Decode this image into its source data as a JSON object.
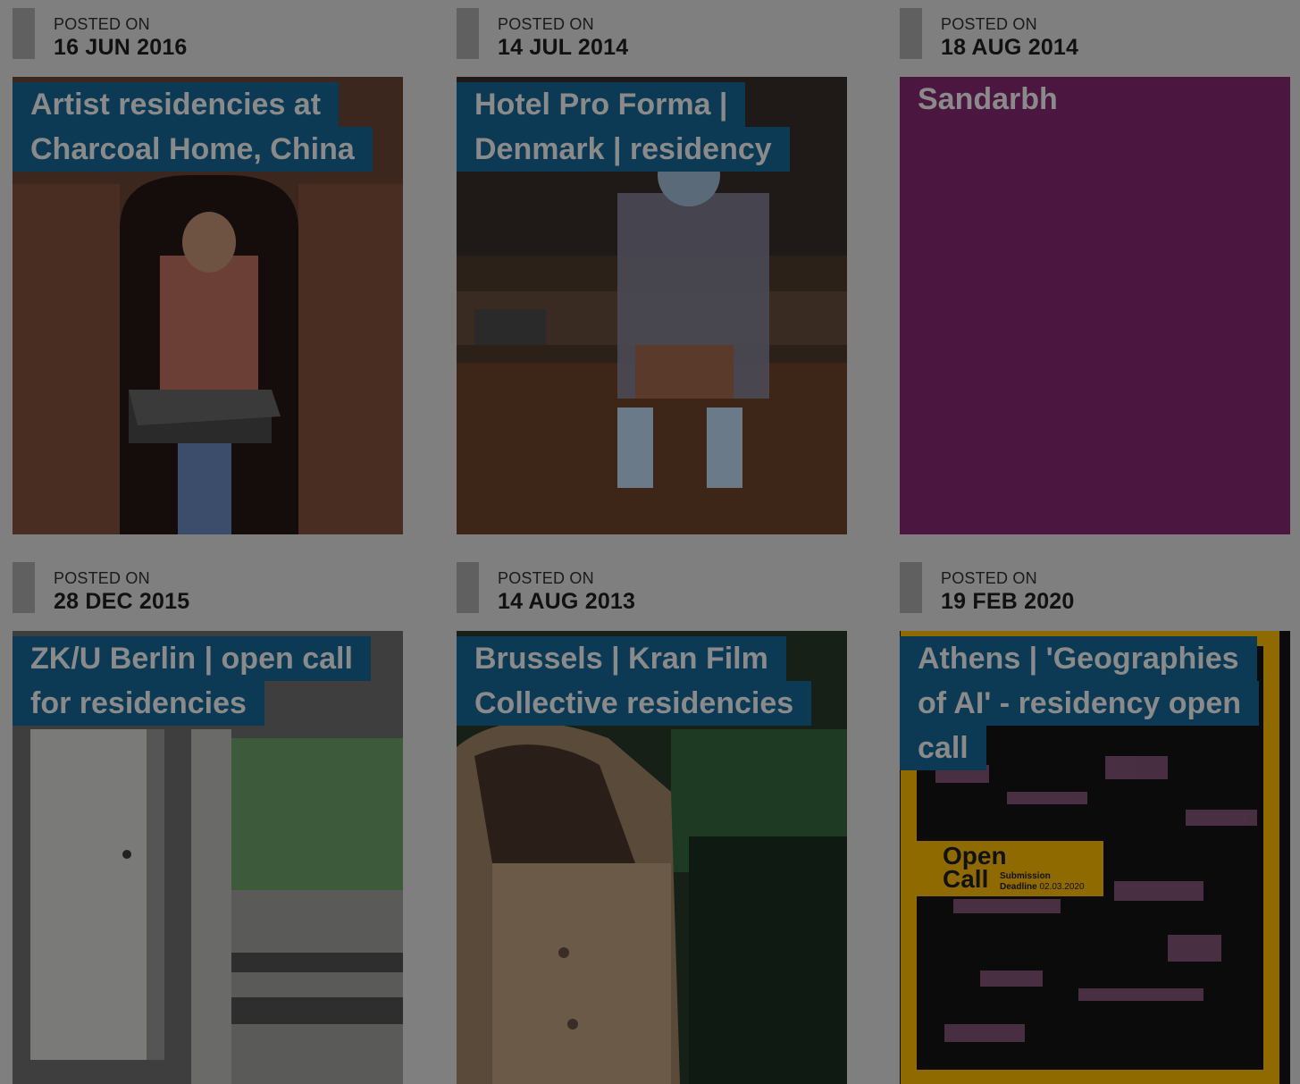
{
  "posted_label": "POSTED ON",
  "cards": [
    {
      "date": "16 JUN 2016",
      "title_lines": [
        "Artist residencies at",
        "Charcoal Home, China"
      ],
      "bg": "#3b271e"
    },
    {
      "date": "14 JUL 2014",
      "title_lines": [
        "Hotel Pro Forma |",
        "Denmark | residency"
      ],
      "bg": "#2b2118"
    },
    {
      "date": "18 AUG 2014",
      "title_lines": [
        "Sandarbh"
      ],
      "bg": "#4b1640"
    },
    {
      "date": "28 DEC 2015",
      "title_lines": [
        "ZK/U Berlin | open call",
        "for residencies"
      ],
      "bg": "#4c4c4c"
    },
    {
      "date": "14 AUG 2013",
      "title_lines": [
        "Brussels | Kran Film",
        "Collective residencies"
      ],
      "bg": "#1b2a1a"
    },
    {
      "date": "19 FEB 2020",
      "title_lines": [
        "Athens | 'Geographies",
        "of AI' - residency open",
        "call"
      ],
      "bg": "#0b0b0b"
    }
  ],
  "poster_text": {
    "open": "Open",
    "call": "Call",
    "submission": "Submission",
    "deadline": "Deadline",
    "deadline_date": "02.03.2020"
  },
  "colors": {
    "title_bg": "#0c3a55",
    "title_text": "#8a8a8a",
    "page_bg": "#7f7f7f",
    "posted_bar": "#606060",
    "sandarbh_bg": "#4b1640",
    "poster_frame": "#8f6a00"
  },
  "icons": []
}
